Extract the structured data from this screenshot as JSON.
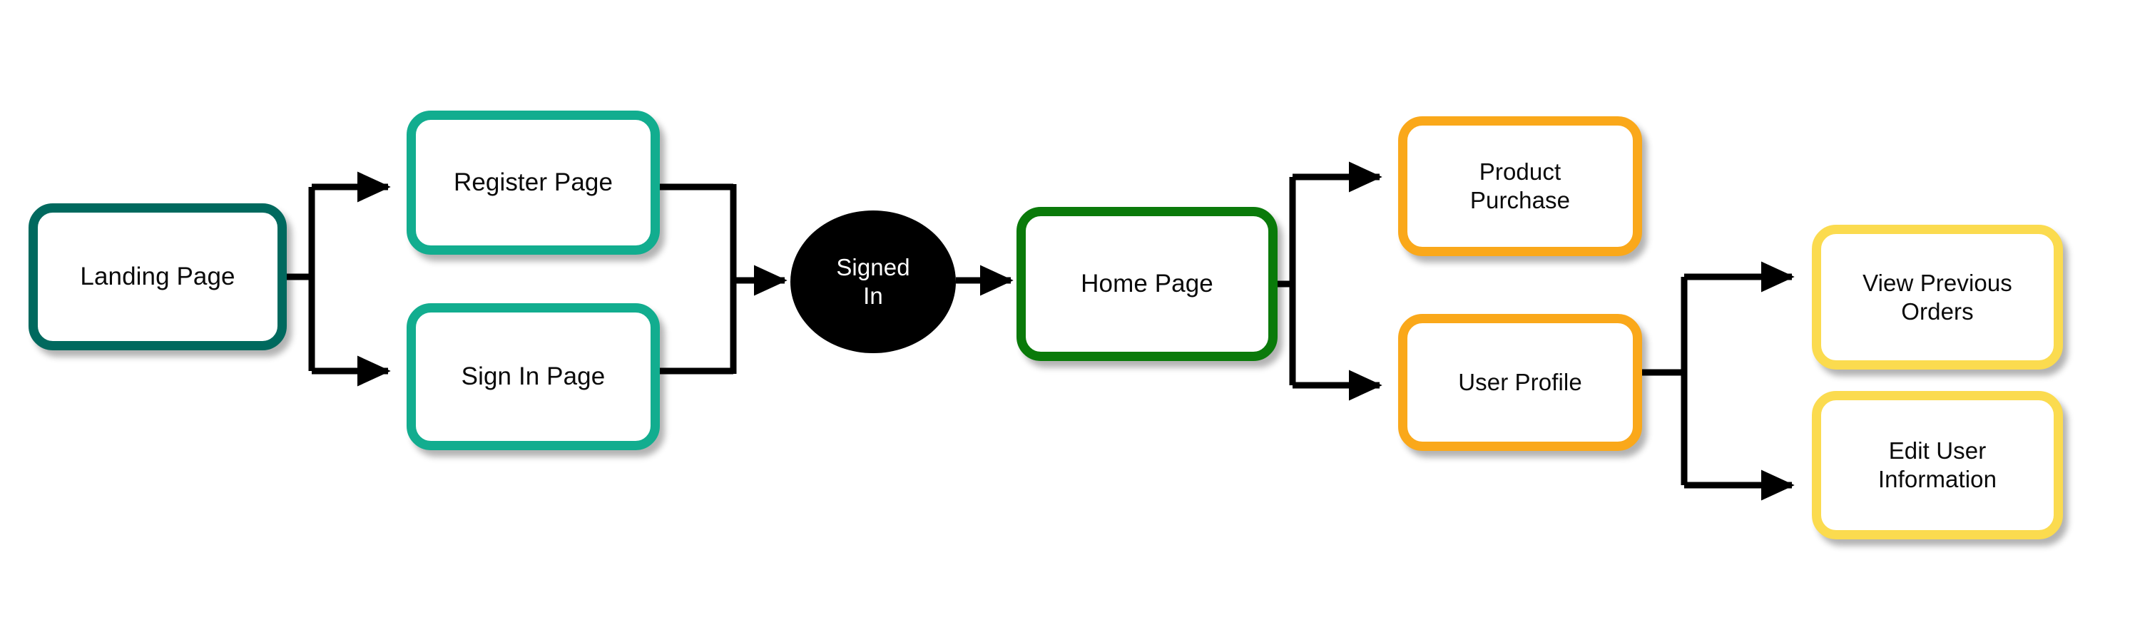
{
  "diagram": {
    "title": "User flow: landing, authentication, home and profile actions",
    "background_color": "#ffffff",
    "edge_color": "#000000",
    "nodes": [
      {
        "id": "landing-page",
        "label": "Landing Page",
        "shape": "rounded-rectangle",
        "border_color": "#00695E",
        "fill_color": "#ffffff",
        "text_color": "#0a0a0a"
      },
      {
        "id": "register-page",
        "label": "Register Page",
        "shape": "rounded-rectangle",
        "border_color": "#12AD8F",
        "fill_color": "#ffffff",
        "text_color": "#0a0a0a"
      },
      {
        "id": "sign-in-page",
        "label": "Sign In Page",
        "shape": "rounded-rectangle",
        "border_color": "#12AD8F",
        "fill_color": "#ffffff",
        "text_color": "#0a0a0a"
      },
      {
        "id": "signed-in",
        "label": "Signed\nIn",
        "shape": "circle",
        "border_color": "#000000",
        "fill_color": "#000000",
        "text_color": "#ffffff"
      },
      {
        "id": "home-page",
        "label": "Home Page",
        "shape": "rounded-rectangle",
        "border_color": "#0A7A0A",
        "fill_color": "#ffffff",
        "text_color": "#0a0a0a"
      },
      {
        "id": "product-purchase",
        "label": "Product\nPurchase",
        "shape": "rounded-rectangle",
        "border_color": "#FAA81A",
        "fill_color": "#ffffff",
        "text_color": "#0a0a0a"
      },
      {
        "id": "user-profile",
        "label": "User Profile",
        "shape": "rounded-rectangle",
        "border_color": "#FAA81A",
        "fill_color": "#ffffff",
        "text_color": "#0a0a0a"
      },
      {
        "id": "view-previous-orders",
        "label": "View Previous\nOrders",
        "shape": "rounded-rectangle",
        "border_color": "#FBDB4F",
        "fill_color": "#ffffff",
        "text_color": "#0a0a0a"
      },
      {
        "id": "edit-user-information",
        "label": "Edit User\nInformation",
        "shape": "rounded-rectangle",
        "border_color": "#FBDB4F",
        "fill_color": "#ffffff",
        "text_color": "#0a0a0a"
      }
    ],
    "edges": [
      {
        "id": "landing-to-register",
        "from": "landing-page",
        "to": "register-page",
        "arrowhead": true
      },
      {
        "id": "landing-to-sign-in",
        "from": "landing-page",
        "to": "sign-in-page",
        "arrowhead": true
      },
      {
        "id": "register-to-signed-in",
        "from": "register-page",
        "to": "signed-in",
        "arrowhead": true
      },
      {
        "id": "sign-in-to-signed-in",
        "from": "sign-in-page",
        "to": "signed-in",
        "arrowhead": true
      },
      {
        "id": "signed-in-to-home",
        "from": "signed-in",
        "to": "home-page",
        "arrowhead": true
      },
      {
        "id": "home-to-product-purchase",
        "from": "home-page",
        "to": "product-purchase",
        "arrowhead": true
      },
      {
        "id": "home-to-user-profile",
        "from": "home-page",
        "to": "user-profile",
        "arrowhead": true
      },
      {
        "id": "profile-to-view-orders",
        "from": "user-profile",
        "to": "view-previous-orders",
        "arrowhead": true
      },
      {
        "id": "profile-to-edit-user-info",
        "from": "user-profile",
        "to": "edit-user-information",
        "arrowhead": true
      }
    ]
  }
}
